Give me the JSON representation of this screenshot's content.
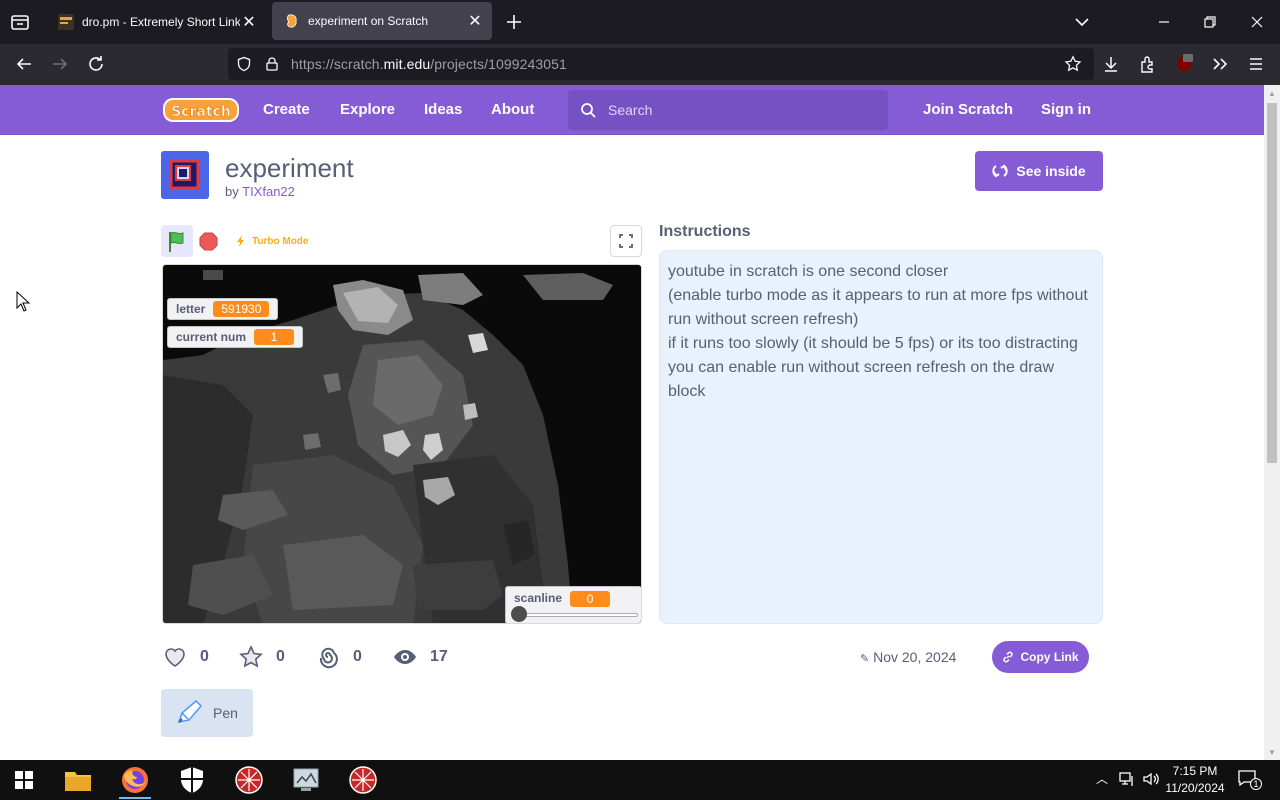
{
  "browser": {
    "tabs": [
      {
        "title": "dro.pm - Extremely Short Links",
        "active": false
      },
      {
        "title": "experiment on Scratch",
        "active": true
      }
    ],
    "url": {
      "prefix": "https://scratch.",
      "domain": "mit.edu",
      "path": "/projects/1099243051"
    }
  },
  "scratch_nav": {
    "logo": "Scratch",
    "links": [
      "Create",
      "Explore",
      "Ideas",
      "About"
    ],
    "search_placeholder": "Search",
    "join": "Join Scratch",
    "signin": "Sign in"
  },
  "project": {
    "title": "experiment",
    "by_label": "by",
    "author": "TIXfan22",
    "see_inside": "See inside",
    "turbo": "Turbo Mode"
  },
  "monitors": {
    "letter": {
      "label": "letter",
      "value": "591930"
    },
    "current_num": {
      "label": "current num",
      "value": "1"
    },
    "scanline": {
      "label": "scanline",
      "value": "0"
    }
  },
  "instructions": {
    "title": "Instructions",
    "lines": [
      "youtube in scratch is one second closer",
      "(enable turbo mode as it appears to run at more fps without run without screen refresh)",
      "if it runs too slowly (it should be 5 fps) or its too distracting you can enable run without screen refresh on the draw block"
    ]
  },
  "stats": {
    "loves": "0",
    "favorites": "0",
    "remixes": "0",
    "views": "17"
  },
  "date": "Nov 20, 2024",
  "copy_link": "Copy Link",
  "extension": "Pen",
  "taskbar": {
    "time": "7:15 PM",
    "date": "11/20/2024",
    "notifications": "1"
  },
  "colors": {
    "scratch_purple": "#855cd6",
    "monitor_orange": "#ff8c1a",
    "text": "#575e75"
  }
}
